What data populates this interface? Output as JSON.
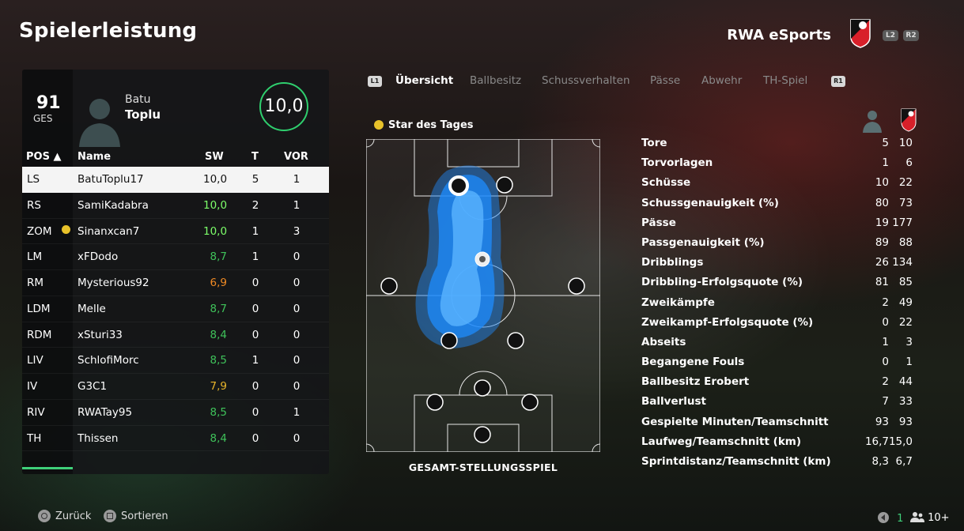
{
  "header": {
    "title": "Spielerleistung",
    "club_name": "RWA eSports",
    "buttons": [
      "L2",
      "R2"
    ]
  },
  "player": {
    "overall": "91",
    "overall_label": "GES",
    "first_name": "Batu",
    "last_name": "Toplu",
    "match_rating": "10,0"
  },
  "table": {
    "headers": {
      "pos": "POS ▲",
      "name": "Name",
      "sw": "SW",
      "t": "T",
      "vor": "VOR"
    },
    "rows": [
      {
        "pos": "LS",
        "name": "BatuToplu17",
        "sw": "10,0",
        "t": "5",
        "vor": "1",
        "color": "#111111",
        "star": false
      },
      {
        "pos": "RS",
        "name": "SamiKadabra",
        "sw": "10,0",
        "t": "2",
        "vor": "1",
        "color": "#7dff6a",
        "star": false
      },
      {
        "pos": "ZOM",
        "name": "Sinanxcan7",
        "sw": "10,0",
        "t": "1",
        "vor": "3",
        "color": "#7dff6a",
        "star": true
      },
      {
        "pos": "LM",
        "name": "xFDodo",
        "sw": "8,7",
        "t": "1",
        "vor": "0",
        "color": "#3fc25a",
        "star": false
      },
      {
        "pos": "RM",
        "name": "Mysterious92",
        "sw": "6,9",
        "t": "0",
        "vor": "0",
        "color": "#f08a24",
        "star": false
      },
      {
        "pos": "LDM",
        "name": "Melle",
        "sw": "8,7",
        "t": "0",
        "vor": "0",
        "color": "#3fc25a",
        "star": false
      },
      {
        "pos": "RDM",
        "name": "xSturi33",
        "sw": "8,4",
        "t": "0",
        "vor": "0",
        "color": "#3fc25a",
        "star": false
      },
      {
        "pos": "LIV",
        "name": "SchlofiMorc",
        "sw": "8,5",
        "t": "1",
        "vor": "0",
        "color": "#3fc25a",
        "star": false
      },
      {
        "pos": "IV",
        "name": "G3C1",
        "sw": "7,9",
        "t": "0",
        "vor": "0",
        "color": "#e8b42a",
        "star": false
      },
      {
        "pos": "RIV",
        "name": "RWATay95",
        "sw": "8,5",
        "t": "0",
        "vor": "1",
        "color": "#3fc25a",
        "star": false
      },
      {
        "pos": "TH",
        "name": "Thissen",
        "sw": "8,4",
        "t": "0",
        "vor": "0",
        "color": "#3fc25a",
        "star": false
      }
    ]
  },
  "tabs": {
    "left_button": "L1",
    "right_button": "R1",
    "items": [
      "Übersicht",
      "Ballbesitz",
      "Schussverhalten",
      "Pässe",
      "Abwehr",
      "TH-Spiel"
    ],
    "active": 0
  },
  "star_of_day": "Star des Tages",
  "pitch_caption": "GESAMT-STELLUNGSSPIEL",
  "stats": [
    {
      "label": "Tore",
      "player": "5",
      "team": "10"
    },
    {
      "label": "Torvorlagen",
      "player": "1",
      "team": "6"
    },
    {
      "label": "Schüsse",
      "player": "10",
      "team": "22"
    },
    {
      "label": "Schussgenauigkeit (%)",
      "player": "80",
      "team": "73"
    },
    {
      "label": "Pässe",
      "player": "19",
      "team": "177"
    },
    {
      "label": "Passgenauigkeit (%)",
      "player": "89",
      "team": "88"
    },
    {
      "label": "Dribblings",
      "player": "26",
      "team": "134"
    },
    {
      "label": "Dribbling-Erfolgsquote (%)",
      "player": "81",
      "team": "85"
    },
    {
      "label": "Zweikämpfe",
      "player": "2",
      "team": "49"
    },
    {
      "label": "Zweikampf-Erfolgsquote (%)",
      "player": "0",
      "team": "22"
    },
    {
      "label": "Abseits",
      "player": "1",
      "team": "3"
    },
    {
      "label": "Begangene Fouls",
      "player": "0",
      "team": "1"
    },
    {
      "label": "Ballbesitz Erobert",
      "player": "2",
      "team": "44"
    },
    {
      "label": "Ballverlust",
      "player": "7",
      "team": "33"
    },
    {
      "label": "Gespielte Minuten/Teamschnitt",
      "player": "93",
      "team": "93"
    },
    {
      "label": "Laufweg/Teamschnitt (km)",
      "player": "16,7",
      "team": "15,0"
    },
    {
      "label": "Sprintdistanz/Teamschnitt (km)",
      "player": "8,3",
      "team": "6,7"
    }
  ],
  "footer": {
    "back_label": "Zurück",
    "sort_label": "Sortieren",
    "page_count": "1",
    "players_count": "10+"
  },
  "colors": {
    "accent_green": "#2fcf6e",
    "heatmap_blue": "#1e8cff",
    "star_yellow": "#e8c22a"
  }
}
